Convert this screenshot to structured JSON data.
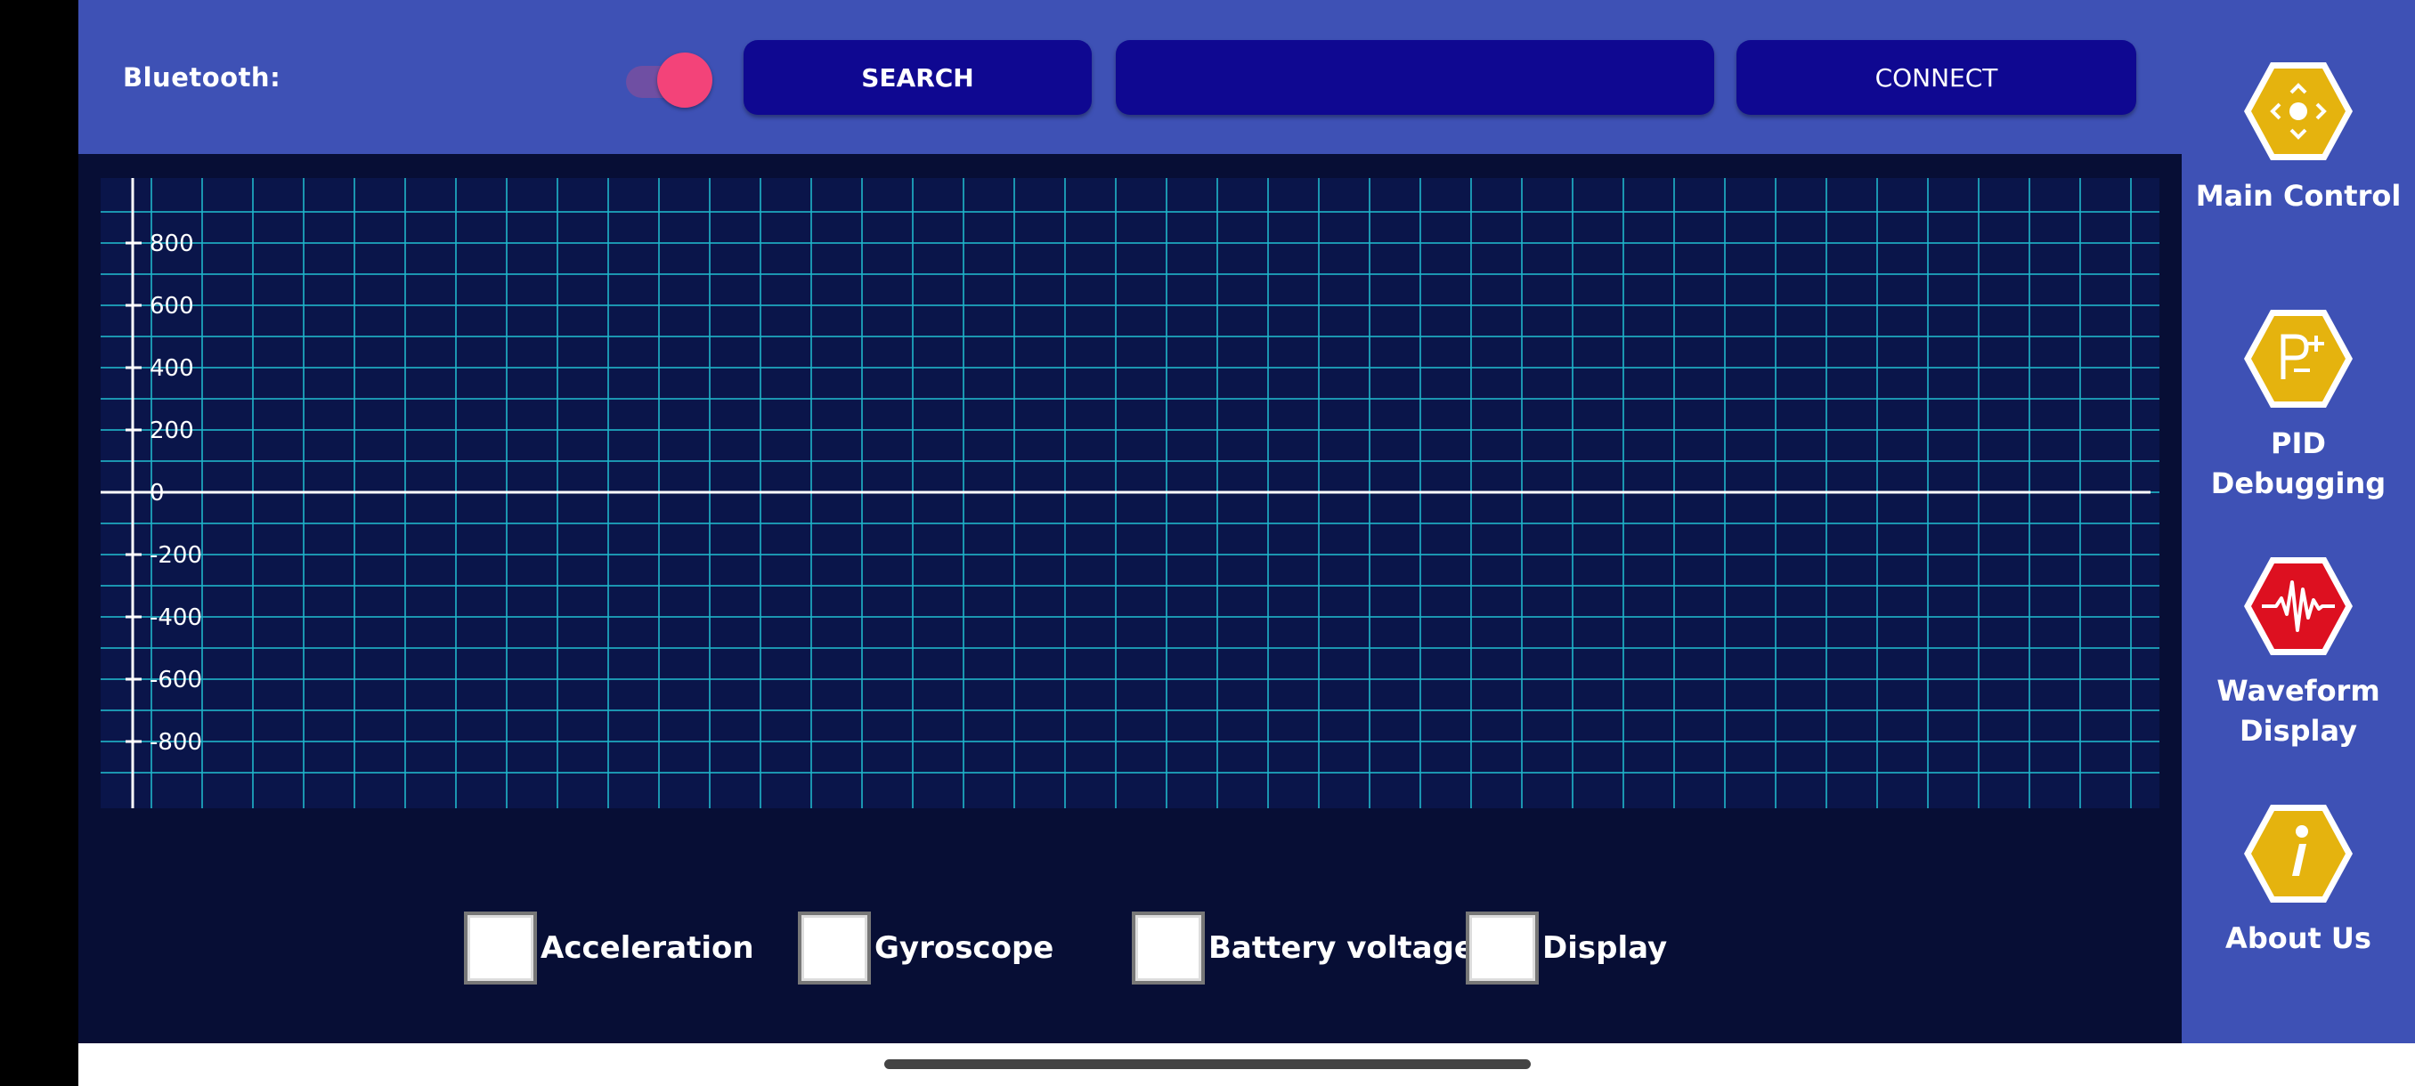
{
  "header": {
    "bluetooth_label": "Bluetooth:",
    "toggle_on": true,
    "search_label": "SEARCH",
    "device_value": "",
    "connect_label": "CONNECT"
  },
  "chart_data": {
    "type": "line",
    "y_ticks": [
      "800",
      "600",
      "400",
      "200",
      "0",
      "-200",
      "-400",
      "-600",
      "-800"
    ],
    "ylim": [
      -1000,
      1000
    ],
    "grid": true,
    "series": []
  },
  "options": [
    {
      "label": "Acceleration",
      "checked": false
    },
    {
      "label": "Gyroscope",
      "checked": false
    },
    {
      "label": "Battery voltage",
      "checked": false
    },
    {
      "label": "Display",
      "checked": false
    }
  ],
  "nav": [
    {
      "label": "Main Control",
      "icon": "dpad-icon",
      "color": "#e5b30e"
    },
    {
      "label": "PID Debugging",
      "icon": "pid-icon",
      "color": "#e5b30e"
    },
    {
      "label": "Waveform Display",
      "icon": "waveform-icon",
      "color": "#dd1020"
    },
    {
      "label": "About Us",
      "icon": "info-icon",
      "color": "#e5b30e"
    }
  ],
  "colors": {
    "panel_blue": "#3e51b5",
    "button_blue": "#0f0891",
    "chart_bg": "#0a154a",
    "grid": "#1fb5c9",
    "toggle_knob": "#f34379"
  }
}
